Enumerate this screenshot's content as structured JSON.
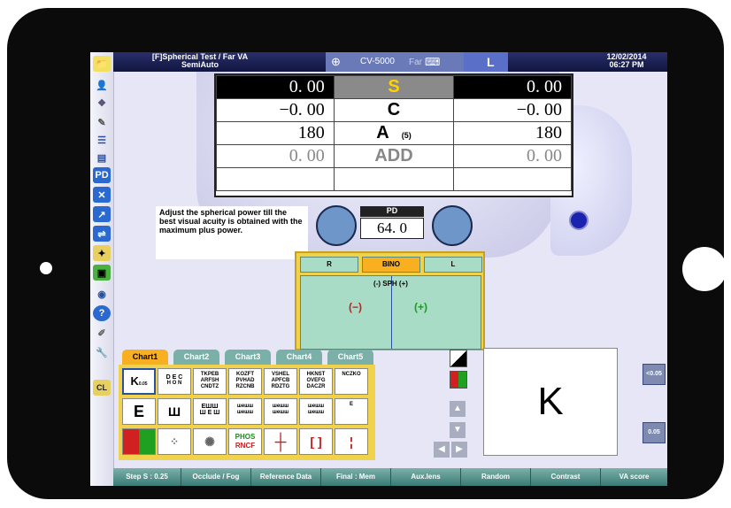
{
  "window": {
    "title_line1": "[F]Spherical Test / Far VA",
    "title_line2": "SemiAuto",
    "model": "CV-5000",
    "eye": "L",
    "date": "12/02/2014",
    "time": "06:27 PM",
    "faded": "Far"
  },
  "rx": {
    "rows": [
      {
        "label": "S",
        "right": "0. 00",
        "left": "0. 00"
      },
      {
        "label": "C",
        "right": "−0. 00",
        "left": "−0. 00"
      },
      {
        "label": "A",
        "label_sub": "(5)",
        "right": "180",
        "left": "180"
      },
      {
        "label": "ADD",
        "right": "0. 00",
        "left": "0. 00"
      }
    ]
  },
  "message": "Adjust the spherical power till the best visual acuity is obtained with the maximum plus power.",
  "pd": {
    "title": "PD",
    "value": "64. 0"
  },
  "panel": {
    "tab_r": "R",
    "tab_bino": "BINO",
    "tab_l": "L",
    "sph_label": "(-) SPH (+)",
    "minus": "(−)",
    "plus": "(+)"
  },
  "charts": {
    "tabs": [
      "Chart1",
      "Chart2",
      "Chart3",
      "Chart4",
      "Chart5"
    ]
  },
  "cells": {
    "c1": "K",
    "c1s": "0.05",
    "c2": "D E C",
    "c2b": "H O N",
    "c3": "TKPEB\nARFSH\nCNDTZ",
    "c4": "KOZFT\nPVHAD\nRZCNB",
    "c5": "VSHEL\nAPFCB\nRDZTG",
    "c6": "HKNST\nOVEFG\nDACZR",
    "c7": "NCZKO",
    "r2c1": "E",
    "r2c2": "Ш",
    "r2c3": "ЕШШ\nШ Е Ш",
    "r2c4": "шешш\nшешш",
    "r2c5": "шешш\nшешш",
    "r2c6": "шешш\nшешш",
    "r2c7": "E",
    "r3c4a": "PHOS",
    "r3c4b": "RNCF"
  },
  "k_display": "K",
  "va_top": "<0.05",
  "va_bottom": "0.05",
  "bottom": [
    "Step S : 0.25",
    "Occlude / Fog",
    "Reference Data",
    "Final : Mem",
    "Aux.lens",
    "Random",
    "Contrast",
    "VA score"
  ]
}
